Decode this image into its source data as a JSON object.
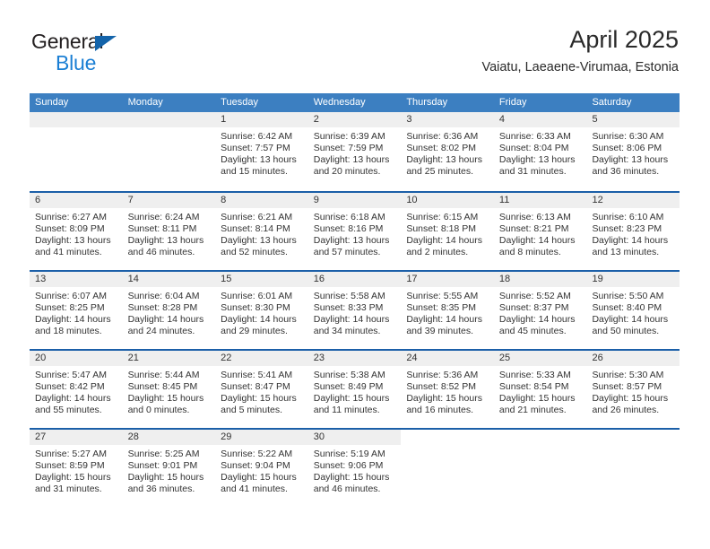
{
  "brand": {
    "name_part1": "General",
    "name_part2": "Blue",
    "logo_icon": "triangle-logo-icon"
  },
  "header": {
    "title": "April 2025",
    "subtitle": "Vaiatu, Laeaene-Virumaa, Estonia"
  },
  "colors": {
    "header_blue": "#3c7fc1",
    "separator_blue": "#1b5fa8",
    "day_band_gray": "#efefef",
    "brand_blue": "#1b7fd4",
    "logo_blue": "#1464aa",
    "text": "#333333"
  },
  "weekdays": [
    "Sunday",
    "Monday",
    "Tuesday",
    "Wednesday",
    "Thursday",
    "Friday",
    "Saturday"
  ],
  "labels": {
    "sunrise_prefix": "Sunrise:",
    "sunset_prefix": "Sunset:",
    "daylight_prefix": "Daylight:"
  },
  "weeks": [
    [
      {
        "day": "",
        "empty": true,
        "blank": false,
        "line1": "",
        "line2": "",
        "line3": "",
        "line4": ""
      },
      {
        "day": "",
        "empty": true,
        "blank": false,
        "line1": "",
        "line2": "",
        "line3": "",
        "line4": ""
      },
      {
        "day": "1",
        "empty": false,
        "blank": false,
        "line1": "Sunrise: 6:42 AM",
        "line2": "Sunset: 7:57 PM",
        "line3": "Daylight: 13 hours",
        "line4": "and 15 minutes."
      },
      {
        "day": "2",
        "empty": false,
        "blank": false,
        "line1": "Sunrise: 6:39 AM",
        "line2": "Sunset: 7:59 PM",
        "line3": "Daylight: 13 hours",
        "line4": "and 20 minutes."
      },
      {
        "day": "3",
        "empty": false,
        "blank": false,
        "line1": "Sunrise: 6:36 AM",
        "line2": "Sunset: 8:02 PM",
        "line3": "Daylight: 13 hours",
        "line4": "and 25 minutes."
      },
      {
        "day": "4",
        "empty": false,
        "blank": false,
        "line1": "Sunrise: 6:33 AM",
        "line2": "Sunset: 8:04 PM",
        "line3": "Daylight: 13 hours",
        "line4": "and 31 minutes."
      },
      {
        "day": "5",
        "empty": false,
        "blank": false,
        "line1": "Sunrise: 6:30 AM",
        "line2": "Sunset: 8:06 PM",
        "line3": "Daylight: 13 hours",
        "line4": "and 36 minutes."
      }
    ],
    [
      {
        "day": "6",
        "empty": false,
        "blank": false,
        "line1": "Sunrise: 6:27 AM",
        "line2": "Sunset: 8:09 PM",
        "line3": "Daylight: 13 hours",
        "line4": "and 41 minutes."
      },
      {
        "day": "7",
        "empty": false,
        "blank": false,
        "line1": "Sunrise: 6:24 AM",
        "line2": "Sunset: 8:11 PM",
        "line3": "Daylight: 13 hours",
        "line4": "and 46 minutes."
      },
      {
        "day": "8",
        "empty": false,
        "blank": false,
        "line1": "Sunrise: 6:21 AM",
        "line2": "Sunset: 8:14 PM",
        "line3": "Daylight: 13 hours",
        "line4": "and 52 minutes."
      },
      {
        "day": "9",
        "empty": false,
        "blank": false,
        "line1": "Sunrise: 6:18 AM",
        "line2": "Sunset: 8:16 PM",
        "line3": "Daylight: 13 hours",
        "line4": "and 57 minutes."
      },
      {
        "day": "10",
        "empty": false,
        "blank": false,
        "line1": "Sunrise: 6:15 AM",
        "line2": "Sunset: 8:18 PM",
        "line3": "Daylight: 14 hours",
        "line4": "and 2 minutes."
      },
      {
        "day": "11",
        "empty": false,
        "blank": false,
        "line1": "Sunrise: 6:13 AM",
        "line2": "Sunset: 8:21 PM",
        "line3": "Daylight: 14 hours",
        "line4": "and 8 minutes."
      },
      {
        "day": "12",
        "empty": false,
        "blank": false,
        "line1": "Sunrise: 6:10 AM",
        "line2": "Sunset: 8:23 PM",
        "line3": "Daylight: 14 hours",
        "line4": "and 13 minutes."
      }
    ],
    [
      {
        "day": "13",
        "empty": false,
        "blank": false,
        "line1": "Sunrise: 6:07 AM",
        "line2": "Sunset: 8:25 PM",
        "line3": "Daylight: 14 hours",
        "line4": "and 18 minutes."
      },
      {
        "day": "14",
        "empty": false,
        "blank": false,
        "line1": "Sunrise: 6:04 AM",
        "line2": "Sunset: 8:28 PM",
        "line3": "Daylight: 14 hours",
        "line4": "and 24 minutes."
      },
      {
        "day": "15",
        "empty": false,
        "blank": false,
        "line1": "Sunrise: 6:01 AM",
        "line2": "Sunset: 8:30 PM",
        "line3": "Daylight: 14 hours",
        "line4": "and 29 minutes."
      },
      {
        "day": "16",
        "empty": false,
        "blank": false,
        "line1": "Sunrise: 5:58 AM",
        "line2": "Sunset: 8:33 PM",
        "line3": "Daylight: 14 hours",
        "line4": "and 34 minutes."
      },
      {
        "day": "17",
        "empty": false,
        "blank": false,
        "line1": "Sunrise: 5:55 AM",
        "line2": "Sunset: 8:35 PM",
        "line3": "Daylight: 14 hours",
        "line4": "and 39 minutes."
      },
      {
        "day": "18",
        "empty": false,
        "blank": false,
        "line1": "Sunrise: 5:52 AM",
        "line2": "Sunset: 8:37 PM",
        "line3": "Daylight: 14 hours",
        "line4": "and 45 minutes."
      },
      {
        "day": "19",
        "empty": false,
        "blank": false,
        "line1": "Sunrise: 5:50 AM",
        "line2": "Sunset: 8:40 PM",
        "line3": "Daylight: 14 hours",
        "line4": "and 50 minutes."
      }
    ],
    [
      {
        "day": "20",
        "empty": false,
        "blank": false,
        "line1": "Sunrise: 5:47 AM",
        "line2": "Sunset: 8:42 PM",
        "line3": "Daylight: 14 hours",
        "line4": "and 55 minutes."
      },
      {
        "day": "21",
        "empty": false,
        "blank": false,
        "line1": "Sunrise: 5:44 AM",
        "line2": "Sunset: 8:45 PM",
        "line3": "Daylight: 15 hours",
        "line4": "and 0 minutes."
      },
      {
        "day": "22",
        "empty": false,
        "blank": false,
        "line1": "Sunrise: 5:41 AM",
        "line2": "Sunset: 8:47 PM",
        "line3": "Daylight: 15 hours",
        "line4": "and 5 minutes."
      },
      {
        "day": "23",
        "empty": false,
        "blank": false,
        "line1": "Sunrise: 5:38 AM",
        "line2": "Sunset: 8:49 PM",
        "line3": "Daylight: 15 hours",
        "line4": "and 11 minutes."
      },
      {
        "day": "24",
        "empty": false,
        "blank": false,
        "line1": "Sunrise: 5:36 AM",
        "line2": "Sunset: 8:52 PM",
        "line3": "Daylight: 15 hours",
        "line4": "and 16 minutes."
      },
      {
        "day": "25",
        "empty": false,
        "blank": false,
        "line1": "Sunrise: 5:33 AM",
        "line2": "Sunset: 8:54 PM",
        "line3": "Daylight: 15 hours",
        "line4": "and 21 minutes."
      },
      {
        "day": "26",
        "empty": false,
        "blank": false,
        "line1": "Sunrise: 5:30 AM",
        "line2": "Sunset: 8:57 PM",
        "line3": "Daylight: 15 hours",
        "line4": "and 26 minutes."
      }
    ],
    [
      {
        "day": "27",
        "empty": false,
        "blank": false,
        "line1": "Sunrise: 5:27 AM",
        "line2": "Sunset: 8:59 PM",
        "line3": "Daylight: 15 hours",
        "line4": "and 31 minutes."
      },
      {
        "day": "28",
        "empty": false,
        "blank": false,
        "line1": "Sunrise: 5:25 AM",
        "line2": "Sunset: 9:01 PM",
        "line3": "Daylight: 15 hours",
        "line4": "and 36 minutes."
      },
      {
        "day": "29",
        "empty": false,
        "blank": false,
        "line1": "Sunrise: 5:22 AM",
        "line2": "Sunset: 9:04 PM",
        "line3": "Daylight: 15 hours",
        "line4": "and 41 minutes."
      },
      {
        "day": "30",
        "empty": false,
        "blank": false,
        "line1": "Sunrise: 5:19 AM",
        "line2": "Sunset: 9:06 PM",
        "line3": "Daylight: 15 hours",
        "line4": "and 46 minutes."
      },
      {
        "day": "",
        "empty": false,
        "blank": true,
        "line1": "",
        "line2": "",
        "line3": "",
        "line4": ""
      },
      {
        "day": "",
        "empty": false,
        "blank": true,
        "line1": "",
        "line2": "",
        "line3": "",
        "line4": ""
      },
      {
        "day": "",
        "empty": false,
        "blank": true,
        "line1": "",
        "line2": "",
        "line3": "",
        "line4": ""
      }
    ]
  ]
}
